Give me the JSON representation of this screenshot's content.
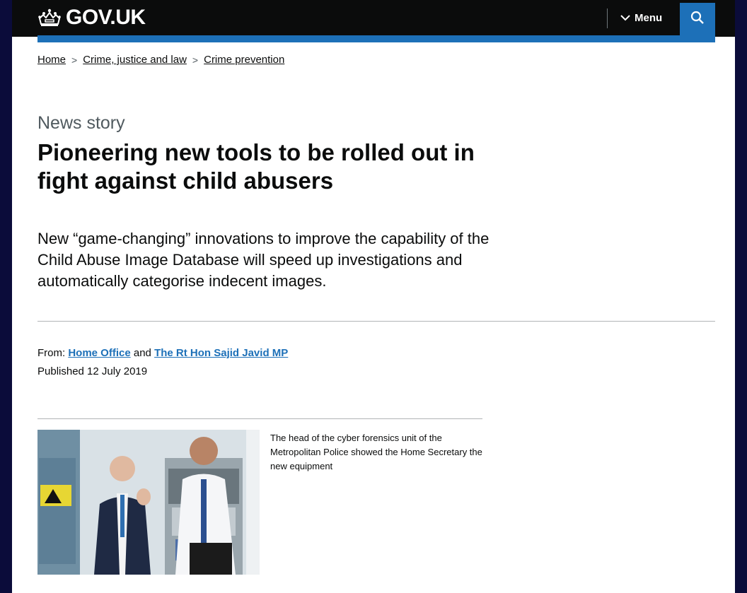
{
  "header": {
    "logo_text": "GOV.UK",
    "menu_label": "Menu",
    "search_icon": "search-icon"
  },
  "breadcrumbs": [
    {
      "label": "Home"
    },
    {
      "label": "Crime, justice and law"
    },
    {
      "label": "Crime prevention"
    }
  ],
  "article": {
    "caption": "News story",
    "title": "Pioneering new tools to be rolled out in fight against child abusers",
    "lead": "New “game-changing” innovations to improve the capability of the Child Abuse Image Database will speed up investigations and automatically categorise indecent images.",
    "from_label": "From:",
    "from_org": "Home Office",
    "and_text": "and",
    "from_person": "The Rt Hon Sajid Javid MP",
    "published": "Published 12 July 2019",
    "figure_caption": "The head of the cyber forensics unit of the Metropolitan Police showed the Home Secretary the new equipment"
  },
  "colors": {
    "header_bg": "#0b0c0c",
    "accent": "#1d70b8",
    "page_bg": "#ffffff"
  }
}
